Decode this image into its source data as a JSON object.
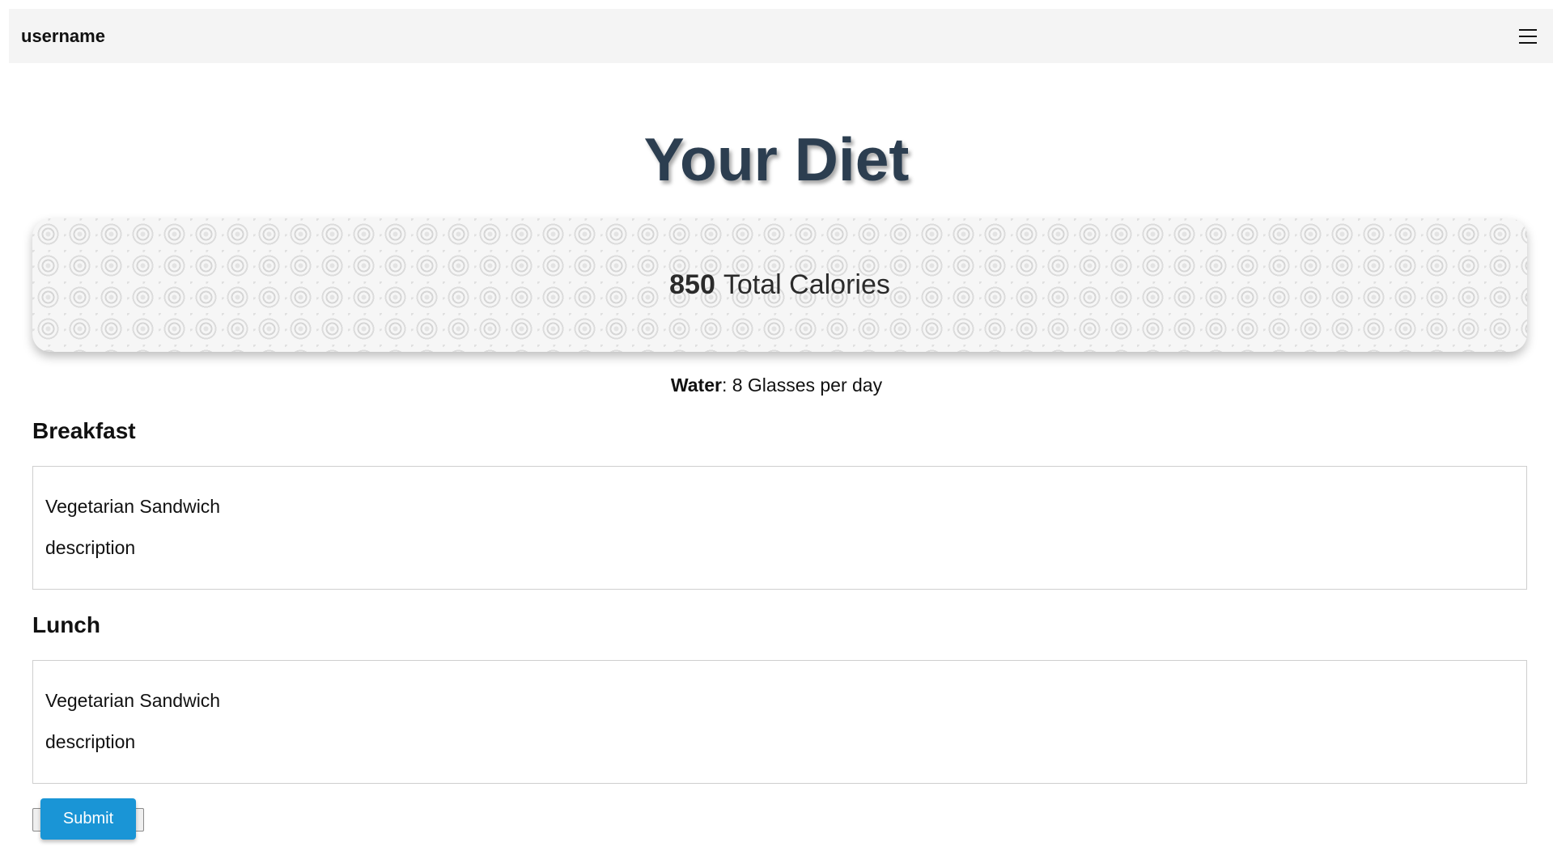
{
  "navbar": {
    "username": "username",
    "menu_icon": "hamburger-menu-icon"
  },
  "page": {
    "title": "Your Diet"
  },
  "calories": {
    "value": "850",
    "label": "Total Calories"
  },
  "water": {
    "label": "Water",
    "text": ": 8 Glasses per day"
  },
  "meals": [
    {
      "heading": "Breakfast",
      "name": "Vegetarian Sandwich",
      "description": "description"
    },
    {
      "heading": "Lunch",
      "name": "Vegetarian Sandwich",
      "description": "description"
    }
  ],
  "actions": {
    "submit_label": "Submit"
  },
  "colors": {
    "title": "#2c3e50",
    "navbar_bg": "#f4f4f4",
    "submit_bg": "#1a95d6",
    "card_border": "#cfcfcf"
  }
}
